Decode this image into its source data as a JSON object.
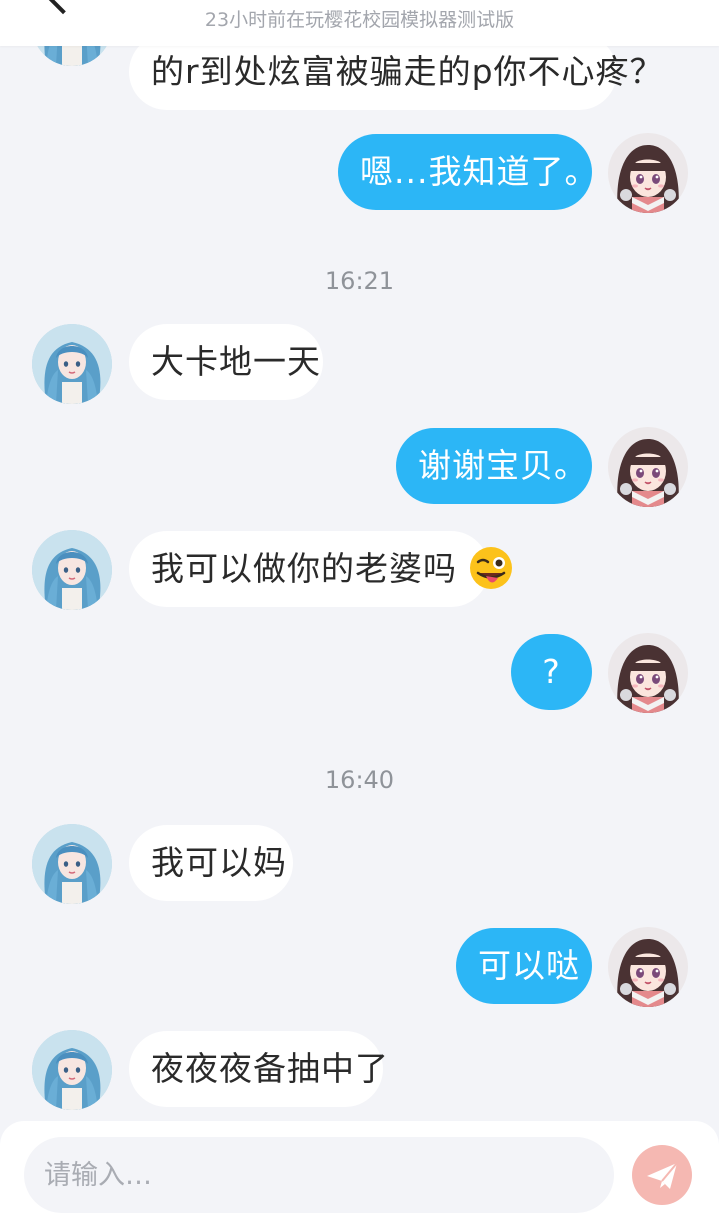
{
  "header": {
    "title": "",
    "subtitle": "23小时前在玩樱花校园模拟器测试版"
  },
  "messages": [
    {
      "side": "in",
      "text": "的r到处炫富被骗走的p你不心疼？"
    },
    {
      "side": "out",
      "text": "嗯...我知道了。"
    },
    {
      "type": "time",
      "text": "16:21"
    },
    {
      "side": "in",
      "text": "大卡地一天"
    },
    {
      "side": "out",
      "text": "谢谢宝贝。"
    },
    {
      "side": "in",
      "text": "我可以做你的老婆吗",
      "emoji": "winking-tongue-emoji"
    },
    {
      "side": "out",
      "text": "?"
    },
    {
      "type": "time",
      "text": "16:40"
    },
    {
      "side": "in",
      "text": "我可以妈"
    },
    {
      "side": "out",
      "text": "可以哒"
    },
    {
      "side": "in",
      "text": "夜夜夜备抽中了"
    }
  ],
  "composer": {
    "placeholder": "请输入…",
    "send_icon": "paper-plane-icon"
  },
  "colors": {
    "outgoing_bubble": "#2cb6f6",
    "incoming_bubble": "#ffffff",
    "background": "#f3f4f8",
    "send_button": "#f5b8b2"
  }
}
